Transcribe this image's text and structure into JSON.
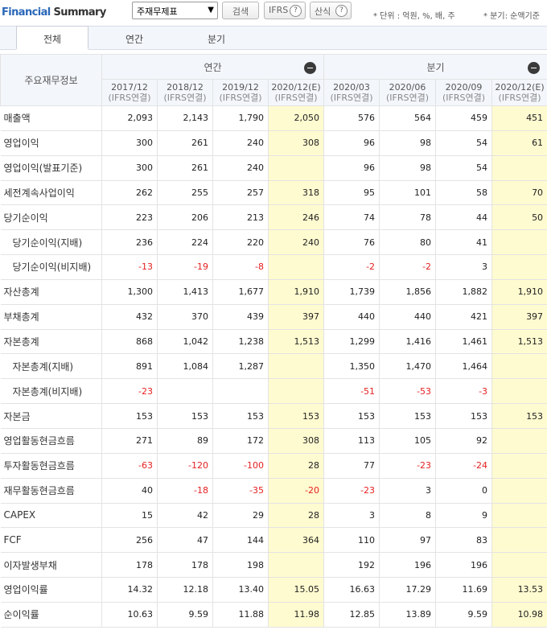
{
  "header": {
    "title_part1": "Financial",
    "title_part2": " Summary",
    "select_value": "주재무제표",
    "search_label": "검색",
    "ifrs_label": "IFRS",
    "formula_label": "산식",
    "help_glyph": "?",
    "unit_note": "* 단위 : 억원, %, 배, 주",
    "quarter_note": "* 분기: 순액기준"
  },
  "tabs": [
    {
      "label": "전체"
    },
    {
      "label": "연간"
    },
    {
      "label": "분기"
    }
  ],
  "table": {
    "corner_label": "주요재무정보",
    "annual_label": "연간",
    "quarterly_label": "분기",
    "periods": [
      {
        "date": "2017/12",
        "basis": "(IFRS연결)"
      },
      {
        "date": "2018/12",
        "basis": "(IFRS연결)"
      },
      {
        "date": "2019/12",
        "basis": "(IFRS연결)"
      },
      {
        "date": "2020/12(E)",
        "basis": "(IFRS연결)"
      },
      {
        "date": "2020/03",
        "basis": "(IFRS연결)"
      },
      {
        "date": "2020/06",
        "basis": "(IFRS연결)"
      },
      {
        "date": "2020/09",
        "basis": "(IFRS연결)"
      },
      {
        "date": "2020/12(E)",
        "basis": "(IFRS연결)"
      }
    ],
    "rows": [
      {
        "label": "매출액",
        "sub": false,
        "values": [
          "2,093",
          "2,143",
          "1,790",
          "2,050",
          "576",
          "564",
          "459",
          "451"
        ]
      },
      {
        "label": "영업이익",
        "sub": false,
        "values": [
          "300",
          "261",
          "240",
          "308",
          "96",
          "98",
          "54",
          "61"
        ]
      },
      {
        "label": "영업이익(발표기준)",
        "sub": false,
        "values": [
          "300",
          "261",
          "240",
          "",
          "96",
          "98",
          "54",
          ""
        ]
      },
      {
        "label": "세전계속사업이익",
        "sub": false,
        "values": [
          "262",
          "255",
          "257",
          "318",
          "95",
          "101",
          "58",
          "70"
        ]
      },
      {
        "label": "당기순이익",
        "sub": false,
        "values": [
          "223",
          "206",
          "213",
          "246",
          "74",
          "78",
          "44",
          "50"
        ]
      },
      {
        "label": "당기순이익(지배)",
        "sub": true,
        "values": [
          "236",
          "224",
          "220",
          "240",
          "76",
          "80",
          "41",
          ""
        ]
      },
      {
        "label": "당기순이익(비지배)",
        "sub": true,
        "values": [
          "-13",
          "-19",
          "-8",
          "",
          "-2",
          "-2",
          "3",
          ""
        ]
      },
      {
        "label": "자산총계",
        "sub": false,
        "values": [
          "1,300",
          "1,413",
          "1,677",
          "1,910",
          "1,739",
          "1,856",
          "1,882",
          "1,910"
        ]
      },
      {
        "label": "부채총계",
        "sub": false,
        "values": [
          "432",
          "370",
          "439",
          "397",
          "440",
          "440",
          "421",
          "397"
        ]
      },
      {
        "label": "자본총계",
        "sub": false,
        "values": [
          "868",
          "1,042",
          "1,238",
          "1,513",
          "1,299",
          "1,416",
          "1,461",
          "1,513"
        ]
      },
      {
        "label": "자본총계(지배)",
        "sub": true,
        "values": [
          "891",
          "1,084",
          "1,287",
          "",
          "1,350",
          "1,470",
          "1,464",
          ""
        ]
      },
      {
        "label": "자본총계(비지배)",
        "sub": true,
        "values": [
          "-23",
          "",
          "",
          "",
          "-51",
          "-53",
          "-3",
          ""
        ]
      },
      {
        "label": "자본금",
        "sub": false,
        "values": [
          "153",
          "153",
          "153",
          "153",
          "153",
          "153",
          "153",
          "153"
        ]
      },
      {
        "label": "영업활동현금흐름",
        "sub": false,
        "values": [
          "271",
          "89",
          "172",
          "308",
          "113",
          "105",
          "92",
          ""
        ]
      },
      {
        "label": "투자활동현금흐름",
        "sub": false,
        "values": [
          "-63",
          "-120",
          "-100",
          "28",
          "77",
          "-23",
          "-24",
          ""
        ]
      },
      {
        "label": "재무활동현금흐름",
        "sub": false,
        "values": [
          "40",
          "-18",
          "-35",
          "-20",
          "-23",
          "3",
          "0",
          ""
        ]
      },
      {
        "label": "CAPEX",
        "sub": false,
        "values": [
          "15",
          "42",
          "29",
          "28",
          "3",
          "8",
          "9",
          ""
        ]
      },
      {
        "label": "FCF",
        "sub": false,
        "values": [
          "256",
          "47",
          "144",
          "364",
          "110",
          "97",
          "83",
          ""
        ]
      },
      {
        "label": "이자발생부채",
        "sub": false,
        "values": [
          "178",
          "178",
          "198",
          "",
          "192",
          "196",
          "196",
          ""
        ]
      },
      {
        "label": "영업이익률",
        "sub": false,
        "values": [
          "14.32",
          "12.18",
          "13.40",
          "15.05",
          "16.63",
          "17.29",
          "11.69",
          "13.53"
        ]
      },
      {
        "label": "순이익률",
        "sub": false,
        "values": [
          "10.63",
          "9.59",
          "11.88",
          "11.98",
          "12.85",
          "13.89",
          "9.59",
          "10.98"
        ]
      }
    ]
  }
}
